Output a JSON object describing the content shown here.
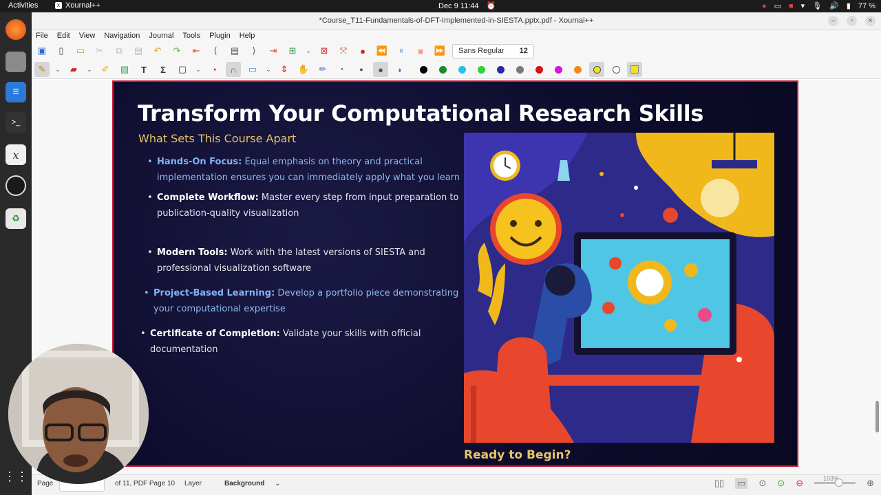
{
  "topbar": {
    "activities": "Activities",
    "app_name": "Xournal++",
    "datetime": "Dec 9  11:44",
    "battery": "77 %"
  },
  "window": {
    "title": "*Course_T11-Fundamentals-of-DFT-Implemented-in-SIESTA.pptx.pdf - Xournal++"
  },
  "menu": [
    "File",
    "Edit",
    "View",
    "Navigation",
    "Journal",
    "Tools",
    "Plugin",
    "Help"
  ],
  "toolbar": {
    "font_name": "Sans Regular",
    "font_size": "12",
    "pen_colors": [
      "#000000",
      "#1d8a2b",
      "#27c0e6",
      "#31d13a",
      "#2a2aa8",
      "#7a7a7a",
      "#d41414",
      "#d616d6",
      "#f08a1e",
      "#f1e31b",
      "#ffffff"
    ],
    "selected_color": "#f1e31b"
  },
  "slide": {
    "title": "Transform Your Computational Research Skills",
    "subtitle": "What Sets This Course Apart",
    "bullets": [
      {
        "key": "Hands-On Focus:",
        "l1": " Equal emphasis on theory and practical",
        "l2": "implementation ensures you can immediately apply what you learn"
      },
      {
        "key": "Complete Workflow:",
        "l1": " Master every step from input preparation to",
        "l2": "publication-quality visualization"
      },
      {
        "key": "Modern Tools:",
        "l1": " Work with the latest versions of SIESTA and",
        "l2": "professional visualization software"
      },
      {
        "key": "Project-Based Learning:",
        "l1": " Develop a portfolio piece demonstrating",
        "l2": "your computational expertise"
      },
      {
        "key": "Certificate of Completion:",
        "l1": " Validate your skills with official",
        "l2": "documentation"
      }
    ],
    "cta": "Ready to Begin?"
  },
  "statusbar": {
    "page_label": "Page",
    "page_value": "",
    "page_of": "of 11, PDF Page 10",
    "layer_label": "Layer",
    "layer_value": "Background",
    "zoom": "103%"
  }
}
